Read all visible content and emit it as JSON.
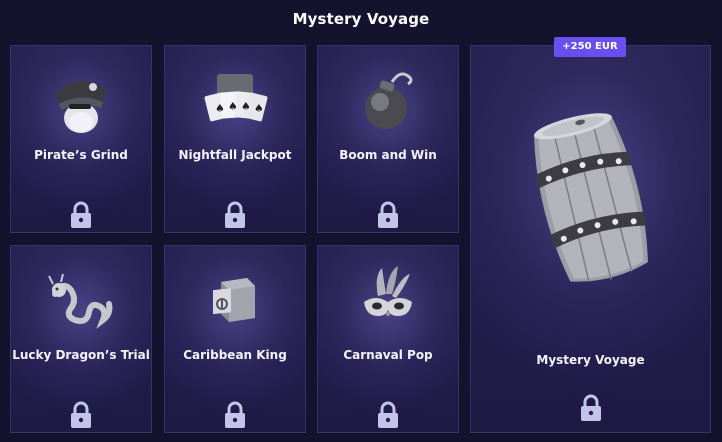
{
  "header": {
    "title": "Mystery Voyage"
  },
  "cards": [
    {
      "label": "Pirate’s Grind",
      "icon": "pirate-hat-icon",
      "locked": true
    },
    {
      "label": "Nightfall Jackpot",
      "icon": "playing-cards-icon",
      "locked": true
    },
    {
      "label": "Boom and Win",
      "icon": "bomb-icon",
      "locked": true
    },
    {
      "label": "Lucky Dragon’s Trial",
      "icon": "dragon-icon",
      "locked": true
    },
    {
      "label": "Caribbean King",
      "icon": "safe-icon",
      "locked": true
    },
    {
      "label": "Carnaval Pop",
      "icon": "carnival-mask-icon",
      "locked": true
    }
  ],
  "featured": {
    "label": "Mystery Voyage",
    "badge": "+250 EUR",
    "icon": "barrel-icon",
    "locked": true
  },
  "colors": {
    "background": "#15122e",
    "card": "#241f4c",
    "border": "#37326a",
    "badge": "#6a4ff0",
    "lock": "#c3c5e8"
  }
}
